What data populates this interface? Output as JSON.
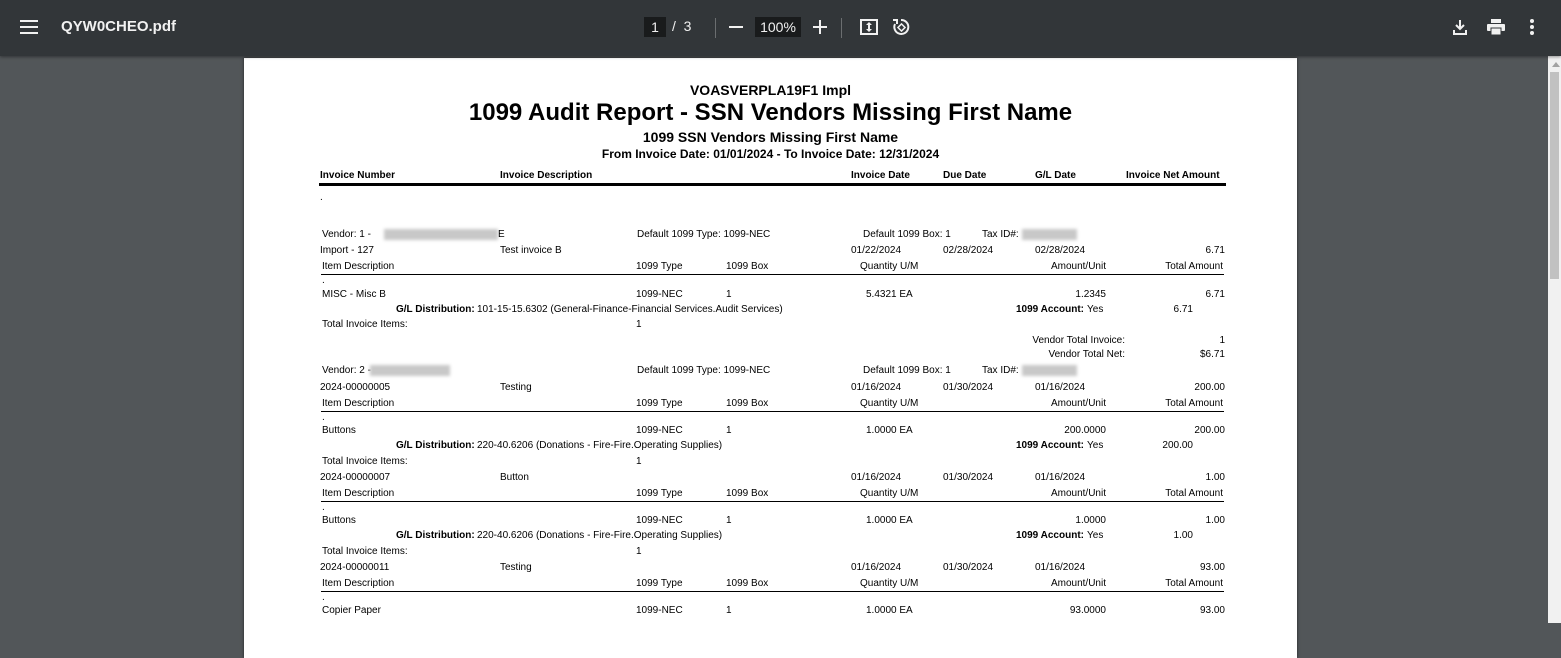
{
  "toolbar": {
    "title": "QYW0CHEO.pdf",
    "current_page": "1",
    "page_sep": "/",
    "total_pages": "3",
    "zoom": "100%"
  },
  "report": {
    "company": "VOASVERPLA19F1 Impl",
    "title": "1099 Audit Report - SSN Vendors Missing First Name",
    "subtitle": "1099 SSN Vendors Missing First Name",
    "date_range": "From Invoice Date: 01/01/2024 - To Invoice Date: 12/31/2024",
    "columns": {
      "invoice_number": "Invoice Number",
      "invoice_description": "Invoice Description",
      "invoice_date": "Invoice Date",
      "due_date": "Due Date",
      "gl_date": "G/L Date",
      "net_amount": "Invoice Net Amount"
    },
    "dot": ".",
    "item_columns": {
      "item_description": "Item Description",
      "type_1099": "1099 Type",
      "box_1099": "1099 Box",
      "quantity": "Quantity U/M",
      "amount_unit": "Amount/Unit",
      "total_amount": "Total Amount"
    },
    "labels": {
      "gl_distribution": "G/L Distribution:",
      "account_1099": "1099 Account:",
      "total_items": "Total Invoice Items:",
      "default_type": "Default 1099 Type: 1099-NEC",
      "default_box": "Default 1099 Box: 1",
      "tax_id": "Tax ID#:",
      "vendor_total_invoice": "Vendor Total Invoice:",
      "vendor_total_net": "Vendor Total Net:"
    },
    "vendor1": {
      "label": "Vendor: 1 -",
      "trail": "E",
      "invoice": {
        "number": "Import - 127",
        "description": "Test invoice B",
        "invoice_date": "01/22/2024",
        "due_date": "02/28/2024",
        "gl_date": "02/28/2024",
        "net": "6.71",
        "item": {
          "description": "MISC - Misc B",
          "type": "1099-NEC",
          "box": "1",
          "quantity": "5.4321 EA",
          "amount_unit": "1.2345",
          "total": "6.71"
        },
        "gl_distribution": "101-15-15.6302 (General-Finance-Financial Services.Audit Services)",
        "account_1099": "Yes",
        "account_amount": "6.71",
        "total_items": "1"
      },
      "total_invoice": "1",
      "total_net": "$6.71"
    },
    "vendor2": {
      "label": "Vendor: 2 -",
      "invoices": [
        {
          "number": "2024-00000005",
          "description": "Testing",
          "invoice_date": "01/16/2024",
          "due_date": "01/30/2024",
          "gl_date": "01/16/2024",
          "net": "200.00",
          "item": {
            "description": "Buttons",
            "type": "1099-NEC",
            "box": "1",
            "quantity": "1.0000 EA",
            "amount_unit": "200.0000",
            "total": "200.00"
          },
          "gl_distribution": "220-40.6206 (Donations - Fire-Fire.Operating Supplies)",
          "account_1099": "Yes",
          "account_amount": "200.00",
          "total_items": "1"
        },
        {
          "number": "2024-00000007",
          "description": "Button",
          "invoice_date": "01/16/2024",
          "due_date": "01/30/2024",
          "gl_date": "01/16/2024",
          "net": "1.00",
          "item": {
            "description": "Buttons",
            "type": "1099-NEC",
            "box": "1",
            "quantity": "1.0000 EA",
            "amount_unit": "1.0000",
            "total": "1.00"
          },
          "gl_distribution": "220-40.6206 (Donations - Fire-Fire.Operating Supplies)",
          "account_1099": "Yes",
          "account_amount": "1.00",
          "total_items": "1"
        },
        {
          "number": "2024-00000011",
          "description": "Testing",
          "invoice_date": "01/16/2024",
          "due_date": "01/30/2024",
          "gl_date": "01/16/2024",
          "net": "93.00",
          "item": {
            "description": "Copier Paper",
            "type": "1099-NEC",
            "box": "1",
            "quantity": "1.0000 EA",
            "amount_unit": "93.0000",
            "total": "93.00"
          }
        }
      ]
    }
  }
}
